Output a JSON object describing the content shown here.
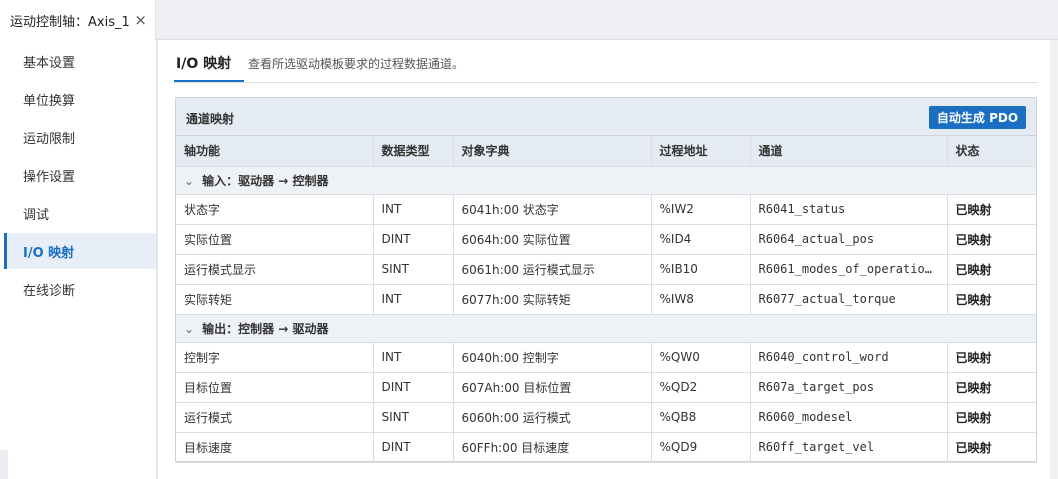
{
  "tab": {
    "title": "运动控制轴：Axis_1",
    "close": "×"
  },
  "sidebar": {
    "items": [
      {
        "label": "基本设置"
      },
      {
        "label": "单位换算"
      },
      {
        "label": "运动限制"
      },
      {
        "label": "操作设置"
      },
      {
        "label": "调试"
      },
      {
        "label": "I/O 映射"
      },
      {
        "label": "在线诊断"
      }
    ],
    "active_index": 5
  },
  "header": {
    "title": "I/O 映射",
    "description": "查看所选驱动模板要求的过程数据通道。"
  },
  "panel": {
    "title": "通道映射",
    "generate_button": "自动生成 PDO",
    "columns": [
      "轴功能",
      "数据类型",
      "对象字典",
      "过程地址",
      "通道",
      "状态"
    ],
    "groups": [
      {
        "label": "输入：驱动器 → 控制器",
        "rows": [
          [
            "状态字",
            "INT",
            "6041h:00 状态字",
            "%IW2",
            "R6041_status",
            "已映射"
          ],
          [
            "实际位置",
            "DINT",
            "6064h:00 实际位置",
            "%ID4",
            "R6064_actual_pos",
            "已映射"
          ],
          [
            "运行模式显示",
            "SINT",
            "6061h:00 运行模式显示",
            "%IB10",
            "R6061_modes_of_operation…",
            "已映射"
          ],
          [
            "实际转矩",
            "INT",
            "6077h:00 实际转矩",
            "%IW8",
            "R6077_actual_torque",
            "已映射"
          ]
        ]
      },
      {
        "label": "输出：控制器 → 驱动器",
        "rows": [
          [
            "控制字",
            "INT",
            "6040h:00 控制字",
            "%QW0",
            "R6040_control_word",
            "已映射"
          ],
          [
            "目标位置",
            "DINT",
            "607Ah:00 目标位置",
            "%QD2",
            "R607a_target_pos",
            "已映射"
          ],
          [
            "运行模式",
            "SINT",
            "6060h:00 运行模式",
            "%QB8",
            "R6060_modesel",
            "已映射"
          ],
          [
            "目标速度",
            "DINT",
            "60FFh:00 目标速度",
            "%QD9",
            "R60ff_target_vel",
            "已映射"
          ]
        ]
      }
    ]
  }
}
